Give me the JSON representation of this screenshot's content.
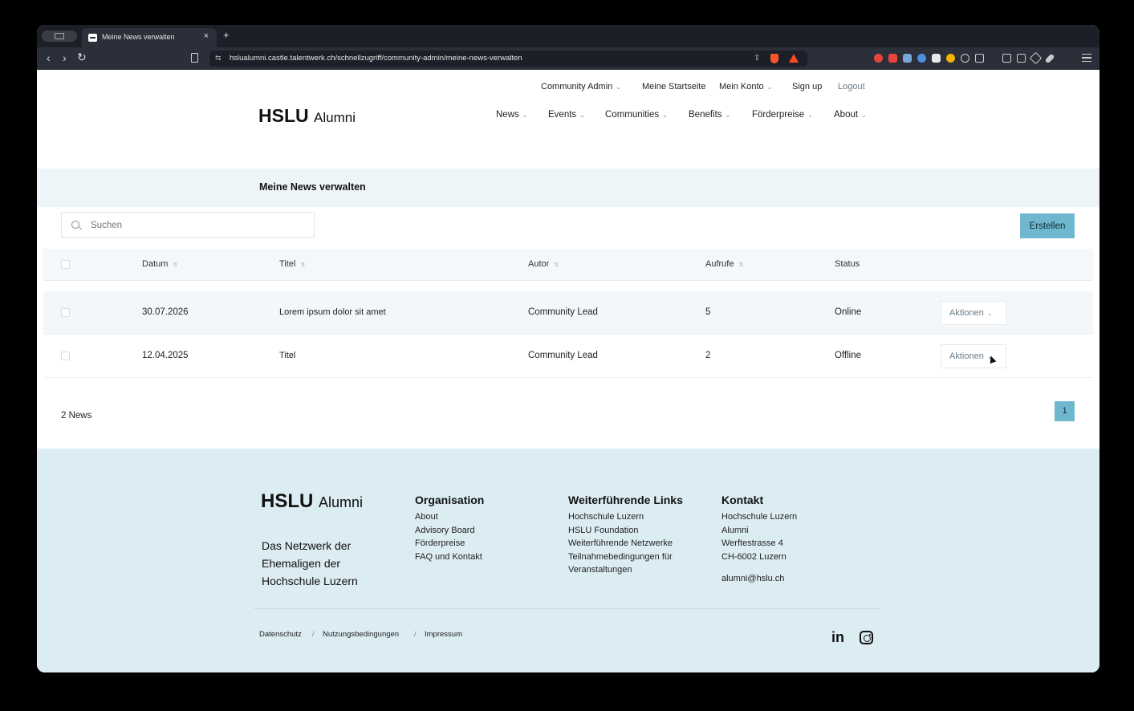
{
  "browser": {
    "tab_title": "Meine News verwalten",
    "tab_close": "×",
    "new_tab": "+",
    "url": "hslualumni.castle.talentwerk.ch/schnellzugriff/community-admin/meine-news-verwalten",
    "back": "‹",
    "forward": "›",
    "reload": "↻"
  },
  "header": {
    "logo_bold": "HSLU",
    "logo_light": "Alumni",
    "top_nav": [
      {
        "label": "Community Admin",
        "dropdown": true
      },
      {
        "label": "Meine Startseite",
        "dropdown": false
      },
      {
        "label": "Mein Konto",
        "dropdown": true
      },
      {
        "label": "Sign up",
        "dropdown": false
      },
      {
        "label": "Logout",
        "dropdown": false
      }
    ],
    "main_nav": [
      "News",
      "Events",
      "Communities",
      "Benefits",
      "Förderpreise",
      "About"
    ]
  },
  "main": {
    "page_title": "Meine News verwalten",
    "search_placeholder": "Suchen",
    "create_label": "Erstellen",
    "columns": [
      "Datum",
      "Titel",
      "Autor",
      "Aufrufe",
      "Status"
    ],
    "rows": [
      {
        "datum": "30.07.2026",
        "titel": "Lorem ipsum dolor sit amet",
        "autor": "Community Lead",
        "aufrufe": "5",
        "status": "Online",
        "action": "Aktionen"
      },
      {
        "datum": "12.04.2025",
        "titel": "Titel",
        "autor": "Community Lead",
        "aufrufe": "2",
        "status": "Offline",
        "action": "Aktionen"
      }
    ],
    "count_label": "2 News",
    "current_page": "1"
  },
  "footer": {
    "logo_bold": "HSLU",
    "logo_light": "Alumni",
    "tagline": "Das Netzwerk der Ehemaligen der Hochschule Luzern",
    "organisation": {
      "heading": "Organisation",
      "links": [
        "About",
        "Advisory Board",
        "Förderpreise",
        "FAQ und Kontakt"
      ]
    },
    "links": {
      "heading": "Weiterführende Links",
      "items": [
        "Hochschule Luzern",
        "HSLU Foundation",
        "Weiterführende Netzwerke",
        "Teilnahmebedingungen für Veranstaltungen"
      ]
    },
    "kontakt": {
      "heading": "Kontakt",
      "lines": [
        "Hochschule Luzern",
        "Alumni",
        "Werftestrasse 4",
        "CH-6002 Luzern"
      ],
      "email": "alumni@hslu.ch"
    },
    "legal": [
      "Datenschutz",
      "Nutzungsbedingungen",
      "Impressum"
    ],
    "legal_sep": "/",
    "social": {
      "linkedin": "in"
    }
  },
  "colors": {
    "accent": "#6fb7ce",
    "footer_bg": "#dbecf3",
    "title_band": "#eef5f9"
  },
  "icons": [
    "search-icon",
    "chevron-down-icon",
    "sort-icon",
    "linkedin-icon",
    "instagram-icon",
    "bookmark-icon",
    "brave-shields-icon",
    "menu-icon"
  ]
}
